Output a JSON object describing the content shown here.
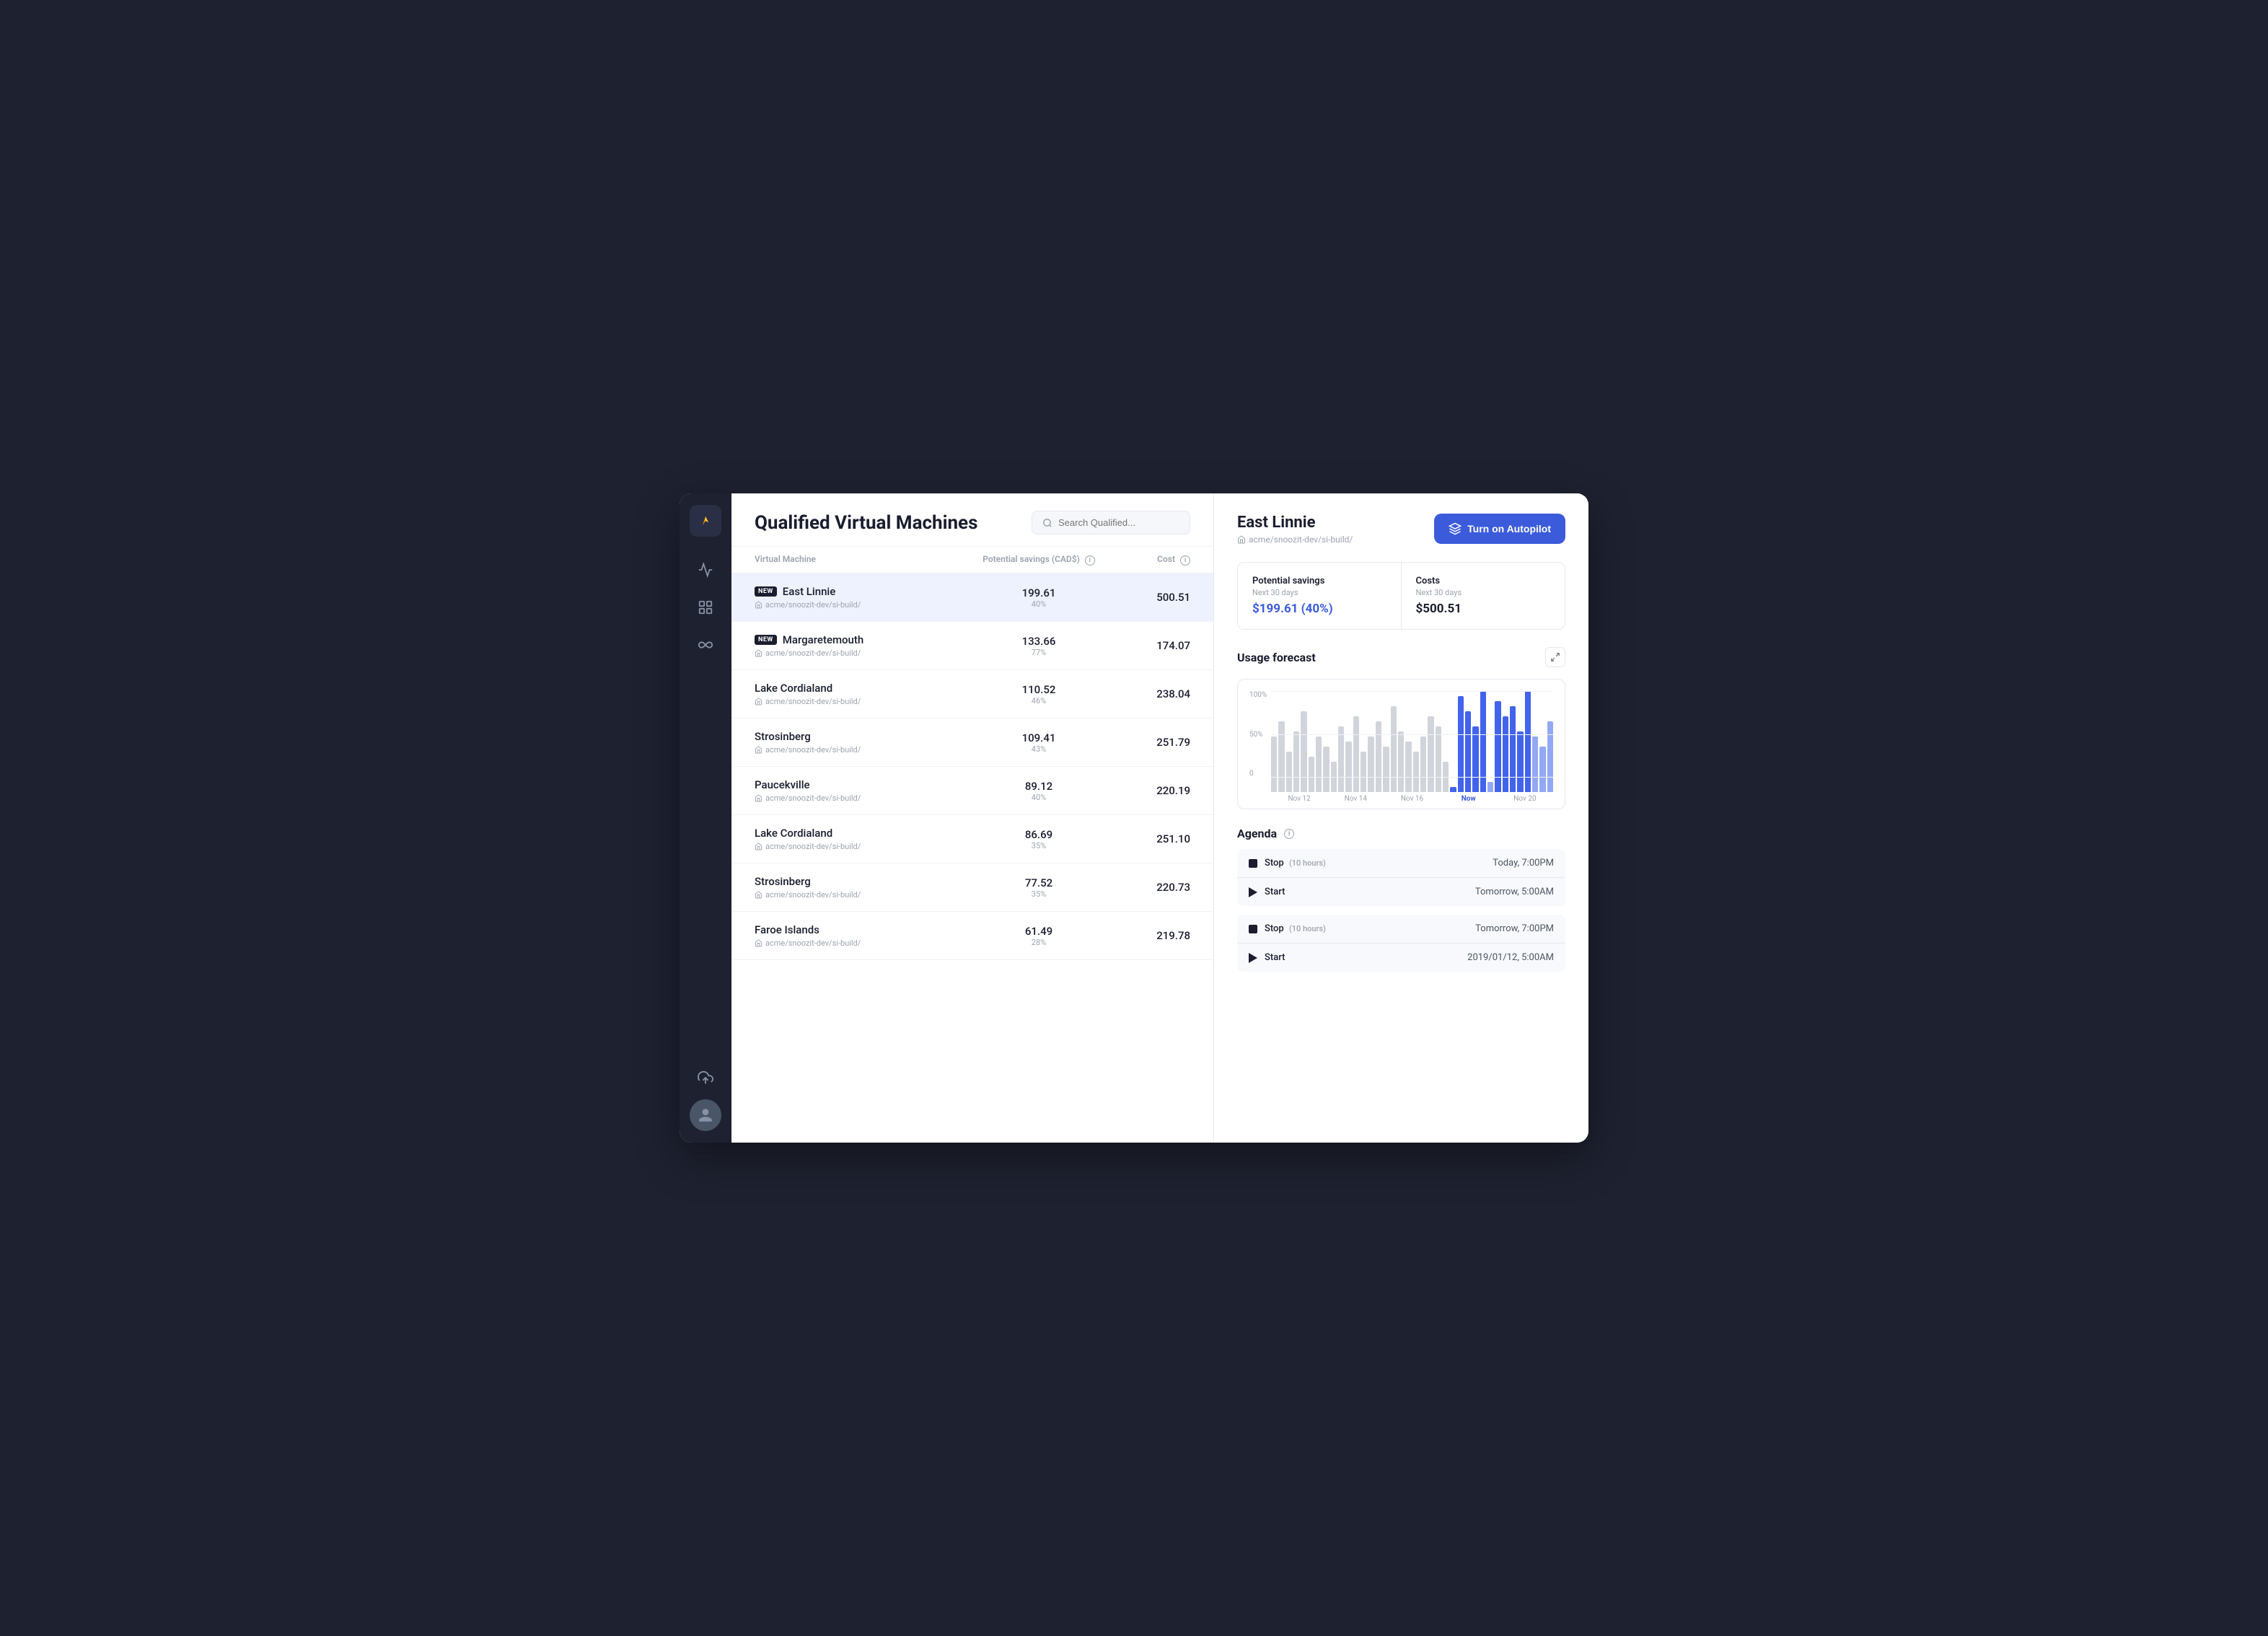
{
  "app": {
    "title": "Qualified Virtual Machines",
    "search_placeholder": "Search Qualified..."
  },
  "colors": {
    "accent": "#3b5bdb",
    "savings": "#3b5bdb",
    "dark": "#1a1d2e",
    "sidebar_bg": "#1e2130"
  },
  "sidebar": {
    "items": [
      {
        "id": "logo",
        "icon": "flame-icon"
      },
      {
        "id": "chart",
        "icon": "chart-icon"
      },
      {
        "id": "filter",
        "icon": "filter-icon"
      },
      {
        "id": "infinity",
        "icon": "infinity-icon"
      },
      {
        "id": "upload",
        "icon": "upload-icon"
      },
      {
        "id": "avatar",
        "icon": "avatar-icon"
      }
    ]
  },
  "table": {
    "columns": {
      "vm": "Virtual Machine",
      "savings": "Potential savings (CAD$)",
      "cost": "Cost"
    },
    "rows": [
      {
        "id": 1,
        "name": "East Linnie",
        "path": "acme/snoozit-dev/si-build/",
        "savings": "199.61",
        "savings_pct": "40%",
        "cost": "500.51",
        "is_new": true,
        "path_icon": "server-icon",
        "selected": true
      },
      {
        "id": 2,
        "name": "Margaretemouth",
        "path": "acme/snoozit-dev/si-build/",
        "savings": "133.66",
        "savings_pct": "77%",
        "cost": "174.07",
        "is_new": true,
        "path_icon": "server-icon",
        "selected": false
      },
      {
        "id": 3,
        "name": "Lake Cordialand",
        "path": "acme/snoozit-dev/si-build/",
        "savings": "110.52",
        "savings_pct": "46%",
        "cost": "238.04",
        "is_new": false,
        "path_icon": "chip-icon",
        "selected": false
      },
      {
        "id": 4,
        "name": "Strosinberg",
        "path": "acme/snoozit-dev/si-build/",
        "savings": "109.41",
        "savings_pct": "43%",
        "cost": "251.79",
        "is_new": false,
        "path_icon": "cloud-icon",
        "selected": false
      },
      {
        "id": 5,
        "name": "Paucekville",
        "path": "acme/snoozit-dev/si-build/",
        "savings": "89.12",
        "savings_pct": "40%",
        "cost": "220.19",
        "is_new": false,
        "path_icon": "chip-icon",
        "selected": false
      },
      {
        "id": 6,
        "name": "Lake Cordialand",
        "path": "acme/snoozit-dev/si-build/",
        "savings": "86.69",
        "savings_pct": "35%",
        "cost": "251.10",
        "is_new": false,
        "path_icon": "chip-icon",
        "selected": false
      },
      {
        "id": 7,
        "name": "Strosinberg",
        "path": "acme/snoozit-dev/si-build/",
        "savings": "77.52",
        "savings_pct": "35%",
        "cost": "220.73",
        "is_new": false,
        "path_icon": "cloud-icon",
        "selected": false
      },
      {
        "id": 8,
        "name": "Faroe Islands",
        "path": "acme/snoozit-dev/si-build/",
        "savings": "61.49",
        "savings_pct": "28%",
        "cost": "219.78",
        "is_new": false,
        "path_icon": "cloud-icon",
        "selected": false
      }
    ]
  },
  "detail": {
    "vm_name": "East Linnie",
    "vm_path": "acme/snoozit-dev/si-build/",
    "autopilot_label": "Turn on Autopilot",
    "potential_savings": {
      "label": "Potential savings",
      "period": "Next 30 days",
      "value": "$199.61 (40%)"
    },
    "costs": {
      "label": "Costs",
      "period": "Next 30 days",
      "value": "$500.51"
    },
    "usage_forecast": {
      "title": "Usage forecast",
      "y_labels": [
        "100%",
        "50%",
        "0"
      ],
      "x_labels": [
        "Nov 12",
        "Nov 14",
        "Nov 16",
        "Now",
        "Nov 20"
      ],
      "bars": [
        {
          "h": 55,
          "type": "past"
        },
        {
          "h": 70,
          "type": "past"
        },
        {
          "h": 40,
          "type": "past"
        },
        {
          "h": 60,
          "type": "past"
        },
        {
          "h": 80,
          "type": "past"
        },
        {
          "h": 35,
          "type": "past"
        },
        {
          "h": 55,
          "type": "past"
        },
        {
          "h": 45,
          "type": "past"
        },
        {
          "h": 30,
          "type": "past"
        },
        {
          "h": 65,
          "type": "past"
        },
        {
          "h": 50,
          "type": "past"
        },
        {
          "h": 75,
          "type": "past"
        },
        {
          "h": 40,
          "type": "past"
        },
        {
          "h": 55,
          "type": "past"
        },
        {
          "h": 70,
          "type": "past"
        },
        {
          "h": 45,
          "type": "past"
        },
        {
          "h": 85,
          "type": "past"
        },
        {
          "h": 60,
          "type": "past"
        },
        {
          "h": 50,
          "type": "past"
        },
        {
          "h": 40,
          "type": "past"
        },
        {
          "h": 55,
          "type": "past"
        },
        {
          "h": 75,
          "type": "past"
        },
        {
          "h": 65,
          "type": "past"
        },
        {
          "h": 30,
          "type": "past"
        },
        {
          "h": 5,
          "type": "future"
        },
        {
          "h": 95,
          "type": "future"
        },
        {
          "h": 80,
          "type": "future"
        },
        {
          "h": 65,
          "type": "future"
        },
        {
          "h": 100,
          "type": "future"
        },
        {
          "h": 10,
          "type": "future-light"
        },
        {
          "h": 90,
          "type": "future"
        },
        {
          "h": 75,
          "type": "future"
        },
        {
          "h": 85,
          "type": "future"
        },
        {
          "h": 60,
          "type": "future"
        },
        {
          "h": 100,
          "type": "future"
        },
        {
          "h": 55,
          "type": "future-light"
        },
        {
          "h": 45,
          "type": "future-light"
        },
        {
          "h": 70,
          "type": "future-light"
        }
      ]
    },
    "agenda": {
      "title": "Agenda",
      "groups": [
        {
          "items": [
            {
              "action": "Stop",
              "duration": "(10 hours)",
              "time": "Today, 7:00PM",
              "type": "stop"
            },
            {
              "action": "Start",
              "duration": "",
              "time": "Tomorrow, 5:00AM",
              "type": "start"
            }
          ]
        },
        {
          "items": [
            {
              "action": "Stop",
              "duration": "(10 hours)",
              "time": "Tomorrow, 7:00PM",
              "type": "stop"
            },
            {
              "action": "Start",
              "duration": "",
              "time": "2019/01/12, 5:00AM",
              "type": "start"
            }
          ]
        }
      ]
    }
  }
}
